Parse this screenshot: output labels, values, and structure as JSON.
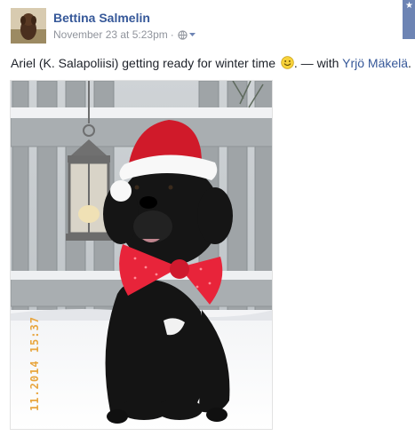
{
  "post": {
    "author": "Bettina Salmelin",
    "timestamp": "November 23 at 5:23pm",
    "separator": "·",
    "privacy_icon": "globe-icon",
    "corner_badge_icon": "star-icon",
    "status": {
      "text": "Ariel (K. Salapoliisi) getting ready for winter time",
      "emoji": "smile-emoji",
      "with_prefix": ". — with",
      "tagged_person": "Yrjö Mäkelä",
      "suffix": "."
    },
    "photo": {
      "subject": "dog-in-santa-hat-photo",
      "date_stamp": "11.2014 15:37"
    }
  },
  "colors": {
    "link": "#365899",
    "meta": "#90949c",
    "text": "#1d2129",
    "datestamp": "#e8a640",
    "badge": "#6d84b4"
  }
}
